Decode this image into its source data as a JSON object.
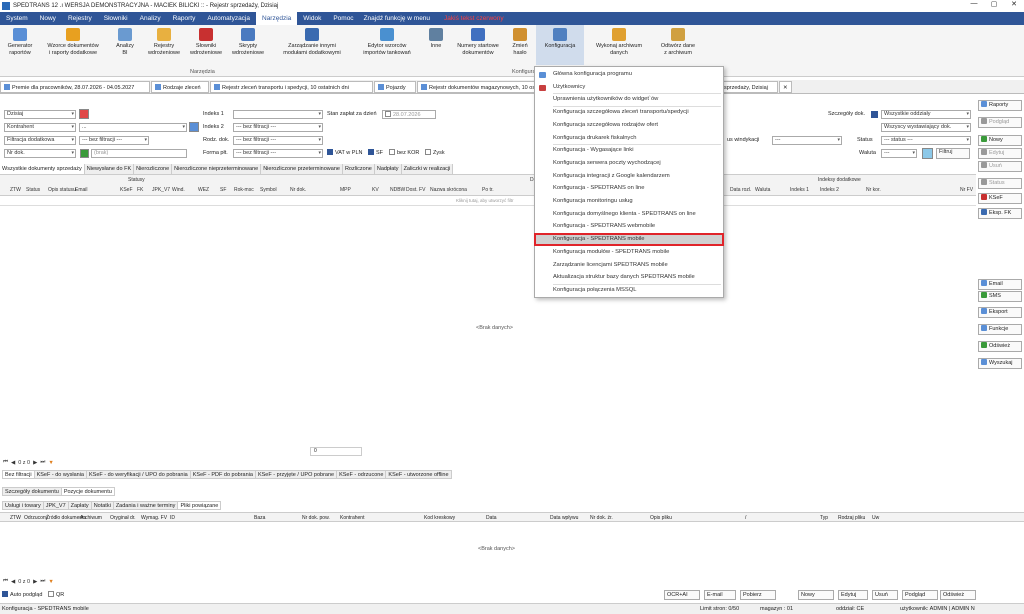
{
  "window": {
    "title": "SPEDTRANS 12 .ı WERSJA DEMONSTRACYJNA - MACIEK BILICKI :: - Rejestr sprzedaży, Dzisiaj",
    "controls": [
      "—",
      "▢",
      "✕"
    ]
  },
  "menu": {
    "items": [
      "System",
      "Nowy",
      "Rejestry",
      "Słowniki",
      "Analizy",
      "Raporty",
      "Automatyzacja",
      "Narzędzia",
      "Widok",
      "Pomoc"
    ],
    "active": "Narzędzia",
    "search": "Znajdź funkcję w menu",
    "red_text": "Jakiś tekst czerwony"
  },
  "ribbon": {
    "buttons": [
      {
        "label": "Generator\nraportów",
        "color": "#5a8fd6"
      },
      {
        "label": "Wzorce dokumentów\ni raporty dodatkowe",
        "color": "#e8a020"
      },
      {
        "label": "Analizy\nBI",
        "color": "#6a9ad0"
      },
      {
        "label": "Rejestry\nwdrożeniowe",
        "color": "#e8b040"
      },
      {
        "label": "Słowniki\nwdrożeniowe",
        "color": "#c83030"
      },
      {
        "label": "Skrypty\nwdrożeniowe",
        "color": "#4a7ac0"
      },
      {
        "label": "Zarządzanie innymi\nmodułami dodatkowymi",
        "color": "#3a6ab0"
      },
      {
        "label": "Edytor wzorców\nimportów tankowań",
        "color": "#4a90d0"
      },
      {
        "label": "Inne",
        "color": "#6080a0"
      },
      {
        "label": "Numery startowe\ndokumentów",
        "color": "#4070c0"
      },
      {
        "label": "Zmień\nhasło",
        "color": "#d09030"
      },
      {
        "label": "Konfiguracja",
        "color": "#5080c0"
      },
      {
        "label": "Wykonaj archiwum\ndanych",
        "color": "#e0a030"
      },
      {
        "label": "Odtwórz dane\nz archiwum",
        "color": "#d0a040"
      }
    ],
    "group_label": "Narzędzia",
    "group_label2": "Konfiguracja"
  },
  "tabs": [
    "Premie dla pracowników, 28.07.2026 - 04.05.2027",
    "Rodzaje zleceń",
    "Rejestr zleceń transportu i spedycji, 10 ostatnich dni",
    "Pojazdy",
    "Rejestr dokumentów magazynowych, 10 ostatnich",
    "owych, 10 ostatnich rekordów (2",
    "Rejestr sprzedaży, Dzisiaj"
  ],
  "filters": {
    "period": "Dzisiaj",
    "kontrahent_label": "Kontrahent",
    "kontrahent_value": "...",
    "filtracja_label": "Filtracja dodatkowa",
    "filtracja_value": "--- bez filtracji ---",
    "nrdok_label": "Nr dok.",
    "nrdok_placeholder": "(brak)",
    "indeks1_label": "Indeks 1",
    "indeks2_label": "Indeks 2",
    "indeks2_value": "--- bez filtracji ---",
    "rodz_label": "Rodz. dok.",
    "rodz_value": "--- bez filtracji ---",
    "forma_label": "Forma płt.",
    "forma_value": "--- bez filtracji ---",
    "stan_label": "Stan zapłat za dzień",
    "stan_date": "28.07.2026",
    "vat_pln": "VAT w PLN",
    "sf": "SF",
    "bez_kor": "bez KOR",
    "zysk": "Zysk",
    "windykacja_label": "us windykacji",
    "windykacja_value": "---",
    "szczegoly_label": "Szczegóły dok.",
    "szczegoly_value": "Wszystkie oddziały",
    "wystawiajacy": "Wszyscy wystawiający dok.",
    "status_label": "Status",
    "status_value": "--- status ---",
    "waluta_label": "Waluta",
    "waluta_value": "---",
    "filtruj": "Filtruj"
  },
  "grid_tabs": [
    "Wszystkie dokumenty sprzedaży",
    "Niewysłane do FK",
    "Nierozliczone",
    "Nierozliczone nieprzeterminowane",
    "Nierozliczone przeterminowane",
    "Rozliczone",
    "Nadpłaty",
    "Zaliczki w realizacji"
  ],
  "grid": {
    "group_statusy": "Statusy",
    "group_dane": "Dane po",
    "group_indeksy": "Indeksy dodatkowe",
    "headers": [
      "ZTW",
      "Status",
      "Opis statusu",
      "Email",
      "KSeF",
      "FK",
      "JPK_V7",
      "Wind.",
      "WEZ",
      "SF",
      "Rok-msc",
      "Symbol",
      "Nr dok.",
      "MPP",
      "KV",
      "NDBW",
      "Dost. FV",
      "Nazwa skrócona",
      "Po tr.",
      "Data rozl.",
      "Waluta",
      "Indeks 1",
      "Indeks 2",
      "Nr kor.",
      "Nr FV"
    ],
    "hint": "Kliknij tutaj, aby utworzyć filtr",
    "empty": "<Brak danych>",
    "sum": "0"
  },
  "pager": {
    "text": "0 z 0"
  },
  "sub_tabs": [
    "Bez filtracji",
    "KSeF - do wysłania",
    "KSeF - do weryfikacji / UPO do pobrania",
    "KSeF - PDF do pobrania",
    "KSeF - przyjęte / UPO pobrane",
    "KSeF - odrzucone",
    "KSeF - utworzone offline"
  ],
  "detail_tabs": [
    "Szczegóły dokumentu",
    "Pozycje dokumentu"
  ],
  "detail_subtabs": [
    "Usługi i towary",
    "JPK_V7",
    "Zapłaty",
    "Notatki",
    "Zadania i ważne terminy",
    "Pliki powiązane"
  ],
  "bottom_grid": {
    "headers": [
      "ZTW",
      "Odrzucony",
      "Źródło dokumentu",
      "Archiwum",
      "Oryginał dr.",
      "Wymag. FV",
      "ID",
      "Baza",
      "Nr dok. pow.",
      "Kontrahent",
      "Kod kreskowy",
      "Data",
      "Data wpływu",
      "Nr dok. źr.",
      "Opis pliku",
      "/",
      "Typ",
      "Rodzaj pliku",
      "Uw"
    ],
    "empty": "<Brak danych>"
  },
  "bottom_buttons": [
    "OCR+AI",
    "E-mail",
    "Pobierz",
    "Nowy",
    "Edytuj",
    "Usuń",
    "Podgląd",
    "Odśwież"
  ],
  "auto_podglad": "Auto podgląd",
  "qr": "QR",
  "sidebar": {
    "buttons": [
      {
        "label": "Raporty",
        "dis": false
      },
      {
        "label": "Podgląd",
        "dis": true
      },
      {
        "label": "Nowy",
        "dis": false
      },
      {
        "label": "Edytuj",
        "dis": true
      },
      {
        "label": "Usuń",
        "dis": true
      },
      {
        "label": "Status",
        "dis": true
      },
      {
        "label": "KSeF",
        "dis": false
      },
      {
        "label": "Eksp. FK",
        "dis": false
      },
      {
        "label": "Email",
        "dis": false
      },
      {
        "label": "SMS",
        "dis": false
      },
      {
        "label": "Eksport",
        "dis": false
      },
      {
        "label": "Funkcje",
        "dis": false
      },
      {
        "label": "Odśwież",
        "dis": false
      },
      {
        "label": "Wyszukaj",
        "dis": false
      }
    ]
  },
  "dropdown": {
    "items": [
      "Główna konfiguracja programu",
      "Użytkownicy",
      "Uprawnienia użytkowników do widget`ów",
      "Konfiguracja szczegółowa zleceń transportu/spedycji",
      "Konfiguracja szczegółowa rodzajów ofert",
      "Konfiguracja drukarek fiskalnych",
      "Konfiguracja - Wygasające linki",
      "Konfiguracja serwera poczty wychodzącej",
      "Konfiguracja integracji z Google kalendarzem",
      "Konfiguracja - SPEDTRANS on line",
      "Konfiguracja monitoringu usług",
      "Konfiguracja domyślnego klienta - SPEDTRANS on line",
      "Konfiguracja - SPEDTRANS webmobile",
      "Konfiguracja - SPEDTRANS mobile",
      "Konfiguracja modułów - SPEDTRANS mobile",
      "Zarządzanie licencjami SPEDTRANS mobile",
      "Aktualizacja struktur bazy danych SPEDTRANS mobile",
      "Konfiguracja połączenia MSSQL"
    ],
    "highlighted": 13
  },
  "status": {
    "left": "Konfiguracja - SPEDTRANS mobile",
    "limit": "Limit stron: 0/50",
    "magazyn": "magazyn : 01",
    "oddzial": "oddział: CE",
    "user": "użytkownik: ADMIN | ADMIN N"
  },
  "colors": {
    "menubar": "#2f5597",
    "highlight_border": "#e0242a"
  }
}
